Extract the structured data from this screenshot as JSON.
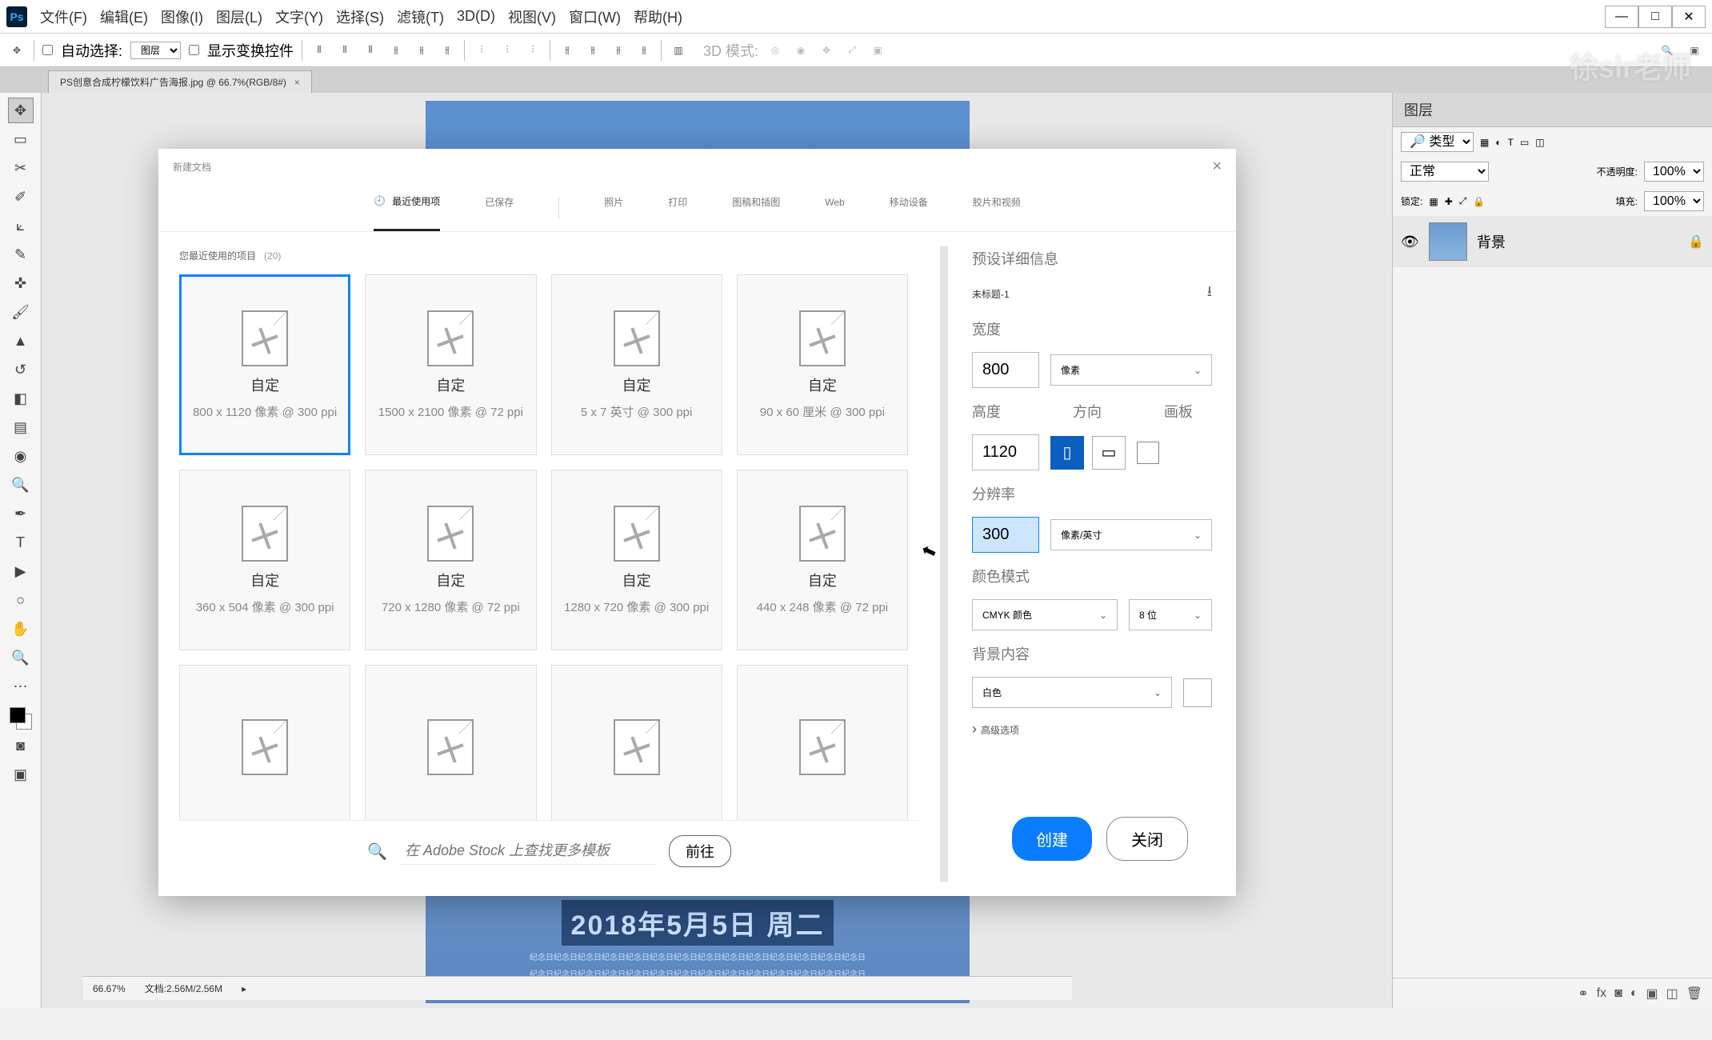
{
  "menubar": {
    "items": [
      "文件(F)",
      "编辑(E)",
      "图像(I)",
      "图层(L)",
      "文字(Y)",
      "选择(S)",
      "滤镜(T)",
      "3D(D)",
      "视图(V)",
      "窗口(W)",
      "帮助(H)"
    ]
  },
  "optbar": {
    "autoSelect": "自动选择:",
    "autoSelectDrop": "图层",
    "showTransform": "显示变换控件",
    "mode3d": "3D 模式:"
  },
  "docTab": "PS创意合成柠檬饮料广告海报.jpg @ 66.7%(RGB/8#)",
  "watermark": "徐sir老师",
  "poster": {
    "date": "2018年5月5日 周二",
    "sub": "纪念日纪念日纪念日纪念日纪念日纪念日纪念日纪念日纪念日纪念日纪念日纪念日纪念日纪念日"
  },
  "status": {
    "zoom": "66.67%",
    "docInfo": "文档:2.56M/2.56M"
  },
  "layersPanel": {
    "title": "图层",
    "kind": "类型",
    "blend": "正常",
    "opacityLabel": "不透明度:",
    "opacity": "100%",
    "lockLabel": "锁定:",
    "fillLabel": "填充:",
    "fill": "100%",
    "layerName": "背景"
  },
  "dialog": {
    "title": "新建文档",
    "tabs": [
      "最近使用项",
      "已保存",
      "照片",
      "打印",
      "图稿和插图",
      "Web",
      "移动设备",
      "胶片和视频"
    ],
    "recentHead": "您最近使用的项目",
    "recentCount": "(20)",
    "presets": [
      {
        "name": "自定",
        "meta": "800 x 1120 像素 @ 300 ppi"
      },
      {
        "name": "自定",
        "meta": "1500 x 2100 像素 @ 72 ppi"
      },
      {
        "name": "自定",
        "meta": "5 x 7 英寸 @ 300 ppi"
      },
      {
        "name": "自定",
        "meta": "90 x 60 厘米 @ 300 ppi"
      },
      {
        "name": "自定",
        "meta": "360 x 504 像素 @ 300 ppi"
      },
      {
        "name": "自定",
        "meta": "720 x 1280 像素 @ 72 ppi"
      },
      {
        "name": "自定",
        "meta": "1280 x 720 像素 @ 300 ppi"
      },
      {
        "name": "自定",
        "meta": "440 x 248 像素 @ 72 ppi"
      },
      {
        "name": "",
        "meta": ""
      },
      {
        "name": "",
        "meta": ""
      },
      {
        "name": "",
        "meta": ""
      },
      {
        "name": "",
        "meta": ""
      }
    ],
    "stockPlaceholder": "在 Adobe Stock 上查找更多模板",
    "goto": "前往",
    "details": {
      "presetInfo": "预设详细信息",
      "docName": "未标题-1",
      "widthLabel": "宽度",
      "width": "800",
      "widthUnit": "像素",
      "heightLabel": "高度",
      "height": "1120",
      "orientLabel": "方向",
      "artboardLabel": "画板",
      "resLabel": "分辨率",
      "res": "300",
      "resUnit": "像素/英寸",
      "colorLabel": "颜色模式",
      "colorMode": "CMYK 颜色",
      "colorDepth": "8 位",
      "bgLabel": "背景内容",
      "bgValue": "白色",
      "advanced": "高级选项"
    },
    "create": "创建",
    "close": "关闭"
  }
}
